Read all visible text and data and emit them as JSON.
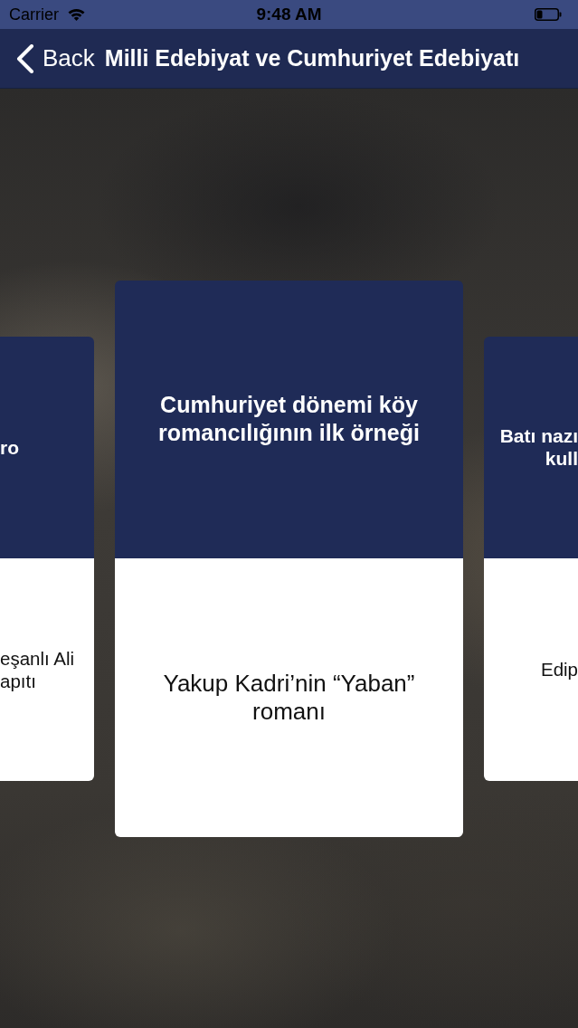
{
  "status_bar": {
    "carrier": "Carrier",
    "time": "9:48 AM"
  },
  "nav_bar": {
    "back_label": "Back",
    "title": "Milli Edebiyat ve Cumhuriyet Edebiyatı"
  },
  "cards": [
    {
      "selected": false,
      "question": "ro",
      "answer": "eşanlı Ali\napıtı"
    },
    {
      "selected": true,
      "question": "Cumhuriyet dönemi köy\nromancılığının ilk örneği",
      "answer": "Yakup Kadri’nin “Yaban”\nromanı"
    },
    {
      "selected": false,
      "question": "Batı nazı\nkull",
      "answer": "Edip"
    }
  ]
}
